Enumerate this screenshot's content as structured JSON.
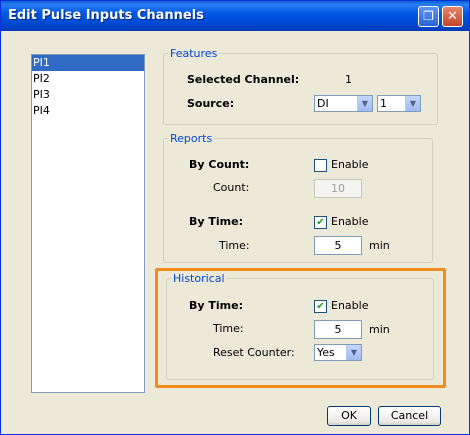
{
  "window": {
    "title": "Edit Pulse Inputs Channels"
  },
  "titlebar_buttons": [
    "restore-icon",
    "close-icon"
  ],
  "channels": [
    "PI1",
    "PI2",
    "PI3",
    "PI4"
  ],
  "selected_channel_index": 0,
  "features": {
    "legend": "Features",
    "selected_channel_label": "Selected Channel:",
    "selected_channel_value": "1",
    "source_label": "Source:",
    "source_type": "DI",
    "source_number": "1"
  },
  "reports": {
    "legend": "Reports",
    "by_count_label": "By Count:",
    "by_count_enable_label": "Enable",
    "by_count_checked": false,
    "count_label": "Count:",
    "count_value": "10",
    "by_time_label": "By Time:",
    "by_time_enable_label": "Enable",
    "by_time_checked": true,
    "time_label": "Time:",
    "time_value": "5",
    "time_unit": "min"
  },
  "historical": {
    "legend": "Historical",
    "by_time_label": "By Time:",
    "by_time_enable_label": "Enable",
    "by_time_checked": true,
    "time_label": "Time:",
    "time_value": "5",
    "time_unit": "min",
    "reset_counter_label": "Reset Counter:",
    "reset_counter_value": "Yes"
  },
  "buttons": {
    "ok": "OK",
    "cancel": "Cancel"
  },
  "colors": {
    "highlight": "#f28a1c",
    "legend": "#0046d5",
    "selection": "#316ac5"
  }
}
